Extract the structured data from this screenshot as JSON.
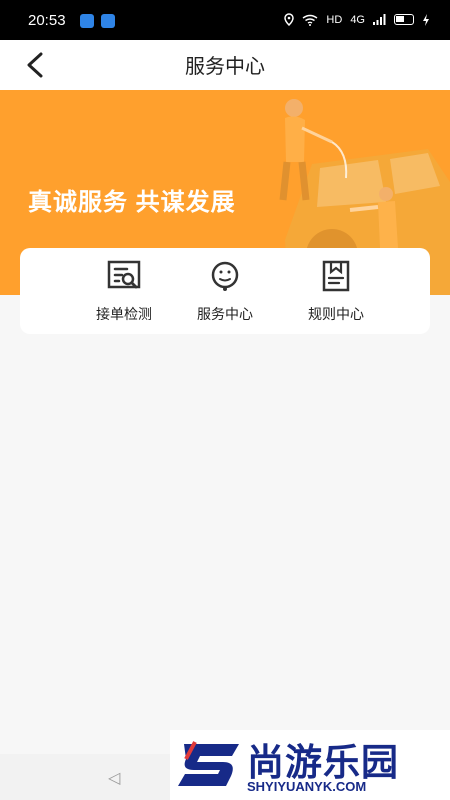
{
  "status_bar": {
    "time": "20:53",
    "network_label": "HD",
    "signal_label": "4G"
  },
  "header": {
    "title": "服务中心"
  },
  "banner": {
    "slogan": "真诚服务 共谋发展",
    "accent_color": "#ffa02d"
  },
  "entries": [
    {
      "label": "接单检测",
      "icon": "document-search-icon"
    },
    {
      "label": "服务中心",
      "icon": "customer-service-icon"
    },
    {
      "label": "规则中心",
      "icon": "rules-book-icon"
    }
  ],
  "watermark": {
    "name": "尚游乐园",
    "domain": "SHYIYUANYK.COM"
  }
}
